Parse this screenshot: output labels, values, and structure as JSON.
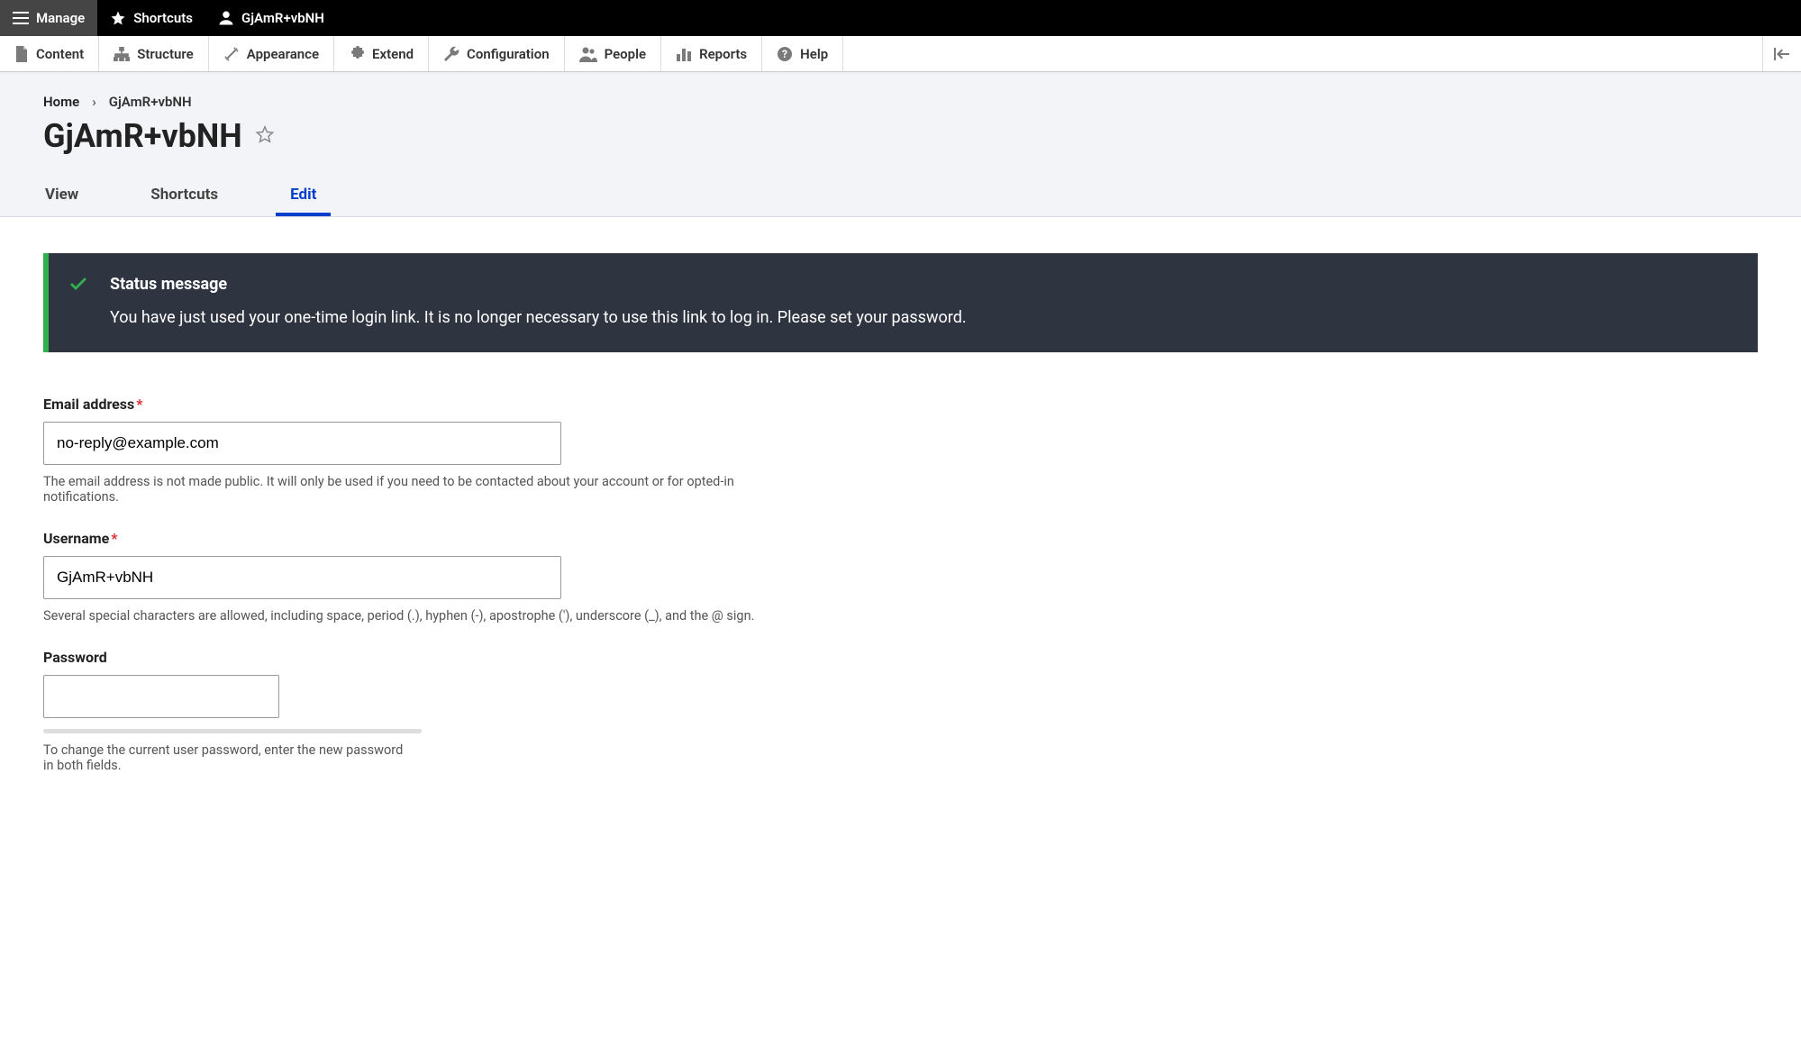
{
  "toolbar": {
    "manage": "Manage",
    "shortcuts": "Shortcuts",
    "user": "GjAmR+vbNH"
  },
  "admin_menu": {
    "content": "Content",
    "structure": "Structure",
    "appearance": "Appearance",
    "extend": "Extend",
    "configuration": "Configuration",
    "people": "People",
    "reports": "Reports",
    "help": "Help"
  },
  "breadcrumb": {
    "home": "Home",
    "sep": "›",
    "current": "GjAmR+vbNH"
  },
  "page_title": "GjAmR+vbNH",
  "tabs": {
    "view": "View",
    "shortcuts": "Shortcuts",
    "edit": "Edit"
  },
  "status": {
    "title": "Status message",
    "body": "You have just used your one-time login link. It is no longer necessary to use this link to log in. Please set your password."
  },
  "form": {
    "email": {
      "label": "Email address",
      "value": "no-reply@example.com",
      "description": "The email address is not made public. It will only be used if you need to be contacted about your account or for opted-in notifications."
    },
    "username": {
      "label": "Username",
      "value": "GjAmR+vbNH",
      "description": "Several special characters are allowed, including space, period (.), hyphen (-), apostrophe ('), underscore (_), and the @ sign."
    },
    "password": {
      "label": "Password",
      "value": "",
      "description": "To change the current user password, enter the new password in both fields."
    }
  }
}
